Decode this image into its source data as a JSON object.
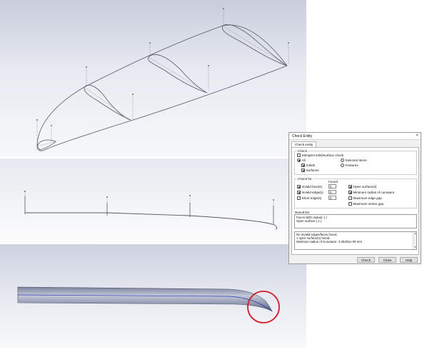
{
  "dialog": {
    "title": "Check Entity",
    "close_glyph": "×",
    "tab": "Check entity",
    "check_group": {
      "label": "Check",
      "stringent": {
        "label": "Stringent solid/surface check",
        "checked": false
      },
      "all": {
        "label": "All",
        "selected": true
      },
      "selected_items": {
        "label": "Selected items",
        "selected": false
      },
      "solids": {
        "label": "Solids",
        "checked": true
      },
      "features": {
        "label": "Features",
        "selected": false
      },
      "surfaces": {
        "label": "Surfaces",
        "checked": true
      }
    },
    "check_for": {
      "label": "Check for",
      "found_header": "Found",
      "invalid_faces": {
        "label": "Invalid face(s)",
        "checked": true,
        "found": "0"
      },
      "invalid_edges": {
        "label": "Invalid edge(s)",
        "checked": true,
        "found": "0"
      },
      "short_edges": {
        "label": "Short edge(s)",
        "checked": false,
        "found": "0"
      },
      "open_surfaces": {
        "label": "Open surface(s)",
        "checked": true
      },
      "min_radius": {
        "label": "Minimum radius of curvature",
        "checked": true
      },
      "min_edge_gap": {
        "label": "Maximum edge gap",
        "checked": false
      },
      "max_vertex_gap": {
        "label": "Maximum vertex gap",
        "checked": false
      }
    },
    "result_list": {
      "label": "Result list",
      "lines": [
        "Faces With radius( 1 )",
        "Open surface ( 1 )"
      ]
    },
    "summary_lines": [
      "No invalid edges/faces found.",
      "1 open surface(s) found.",
      "Minimum radius of Curvature: 4.35251e-09 mm"
    ],
    "buttons": {
      "check": "Check",
      "close": "Close",
      "help": "Help"
    }
  },
  "colors": {
    "highlight_circle": "#d0202a",
    "model_edges": "#555a66",
    "surface_dark": "#565d78",
    "surface_light": "#c3c8d8"
  },
  "icons": {
    "dialog_close": "close-icon",
    "checkbox": "checkbox-icon",
    "radio": "radio-icon"
  }
}
